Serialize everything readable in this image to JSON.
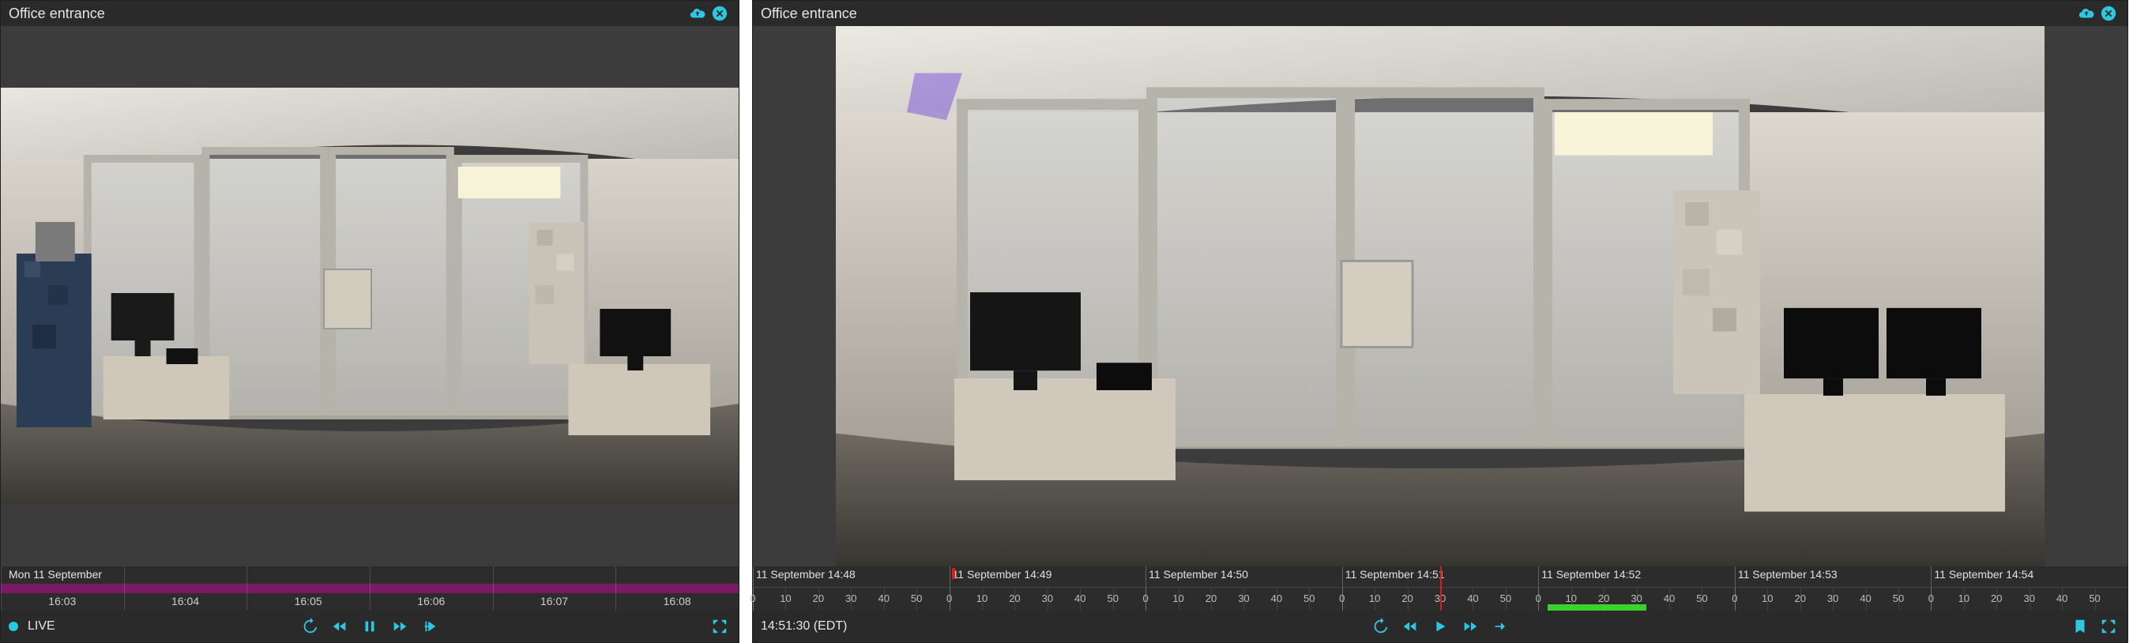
{
  "colors": {
    "accent": "#2ec7e0",
    "event_green": "#3ad12d",
    "event_red": "#e01a1a",
    "timeline_purple": "#7a1a64"
  },
  "left": {
    "title": "Office entrance",
    "date_label": "Mon 11 September",
    "live_label": "LIVE",
    "ticks": [
      "16:03",
      "16:04",
      "16:05",
      "16:06",
      "16:07",
      "16:08"
    ]
  },
  "right": {
    "title": "Office entrance",
    "time_label": "14:51:30 (EDT)",
    "segments": [
      {
        "label": "11 September 14:48"
      },
      {
        "label": "11 September 14:49"
      },
      {
        "label": "11 September 14:50"
      },
      {
        "label": "11 September 14:51"
      },
      {
        "label": "11 September 14:52"
      },
      {
        "label": "11 September 14:53"
      },
      {
        "label": "11 September 14:54"
      }
    ],
    "minor_ticks": [
      "0",
      "10",
      "20",
      "30",
      "40",
      "50"
    ],
    "playhead_pct": 50.0,
    "events": {
      "red_pct": 14.5,
      "green_start_pct": 57.8,
      "green_width_pct": 7.2
    }
  }
}
